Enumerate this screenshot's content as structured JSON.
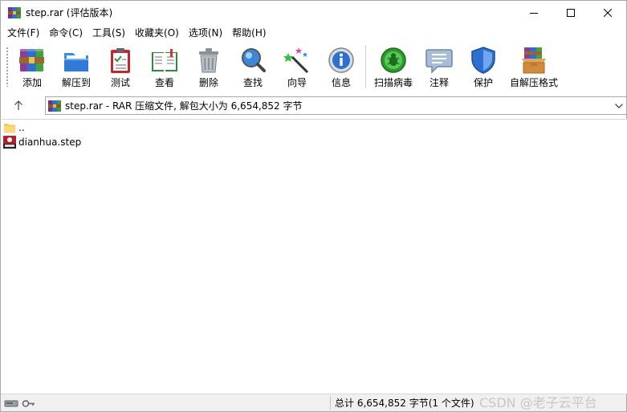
{
  "window": {
    "title": "step.rar (评估版本)",
    "controls": {
      "minimize": "—",
      "maximize": "☐",
      "close": "✕"
    }
  },
  "menu": [
    "文件(F)",
    "命令(C)",
    "工具(S)",
    "收藏夹(O)",
    "选项(N)",
    "帮助(H)"
  ],
  "toolbar": {
    "buttons": [
      {
        "label": "添加",
        "icon": "add-archive-icon"
      },
      {
        "label": "解压到",
        "icon": "extract-folder-icon"
      },
      {
        "label": "测试",
        "icon": "test-clipboard-icon"
      },
      {
        "label": "查看",
        "icon": "view-book-icon"
      },
      {
        "label": "删除",
        "icon": "trash-icon"
      },
      {
        "label": "查找",
        "icon": "magnifier-icon"
      },
      {
        "label": "向导",
        "icon": "wizard-wand-icon"
      },
      {
        "label": "信息",
        "icon": "info-icon"
      },
      {
        "label": "扫描病毒",
        "icon": "virus-scan-icon"
      },
      {
        "label": "注释",
        "icon": "comment-icon"
      },
      {
        "label": "保护",
        "icon": "shield-icon"
      },
      {
        "label": "自解压格式",
        "icon": "sfx-box-icon"
      }
    ]
  },
  "address": {
    "up_icon": "up-arrow-icon",
    "text": "step.rar - RAR 压缩文件, 解包大小为 6,654,852 字节"
  },
  "files": [
    {
      "name": "..",
      "icon": "folder-icon"
    },
    {
      "name": "dianhua.step",
      "icon": "step-file-icon"
    }
  ],
  "status": {
    "summary": "总计 6,654,852 字节(1 个文件)",
    "watermark": "CSDN @老子云平台"
  },
  "colors": {
    "accent_blue": "#1e6fd9",
    "winrar_red": "#c0282d",
    "status_bg": "#f0f0f0"
  }
}
